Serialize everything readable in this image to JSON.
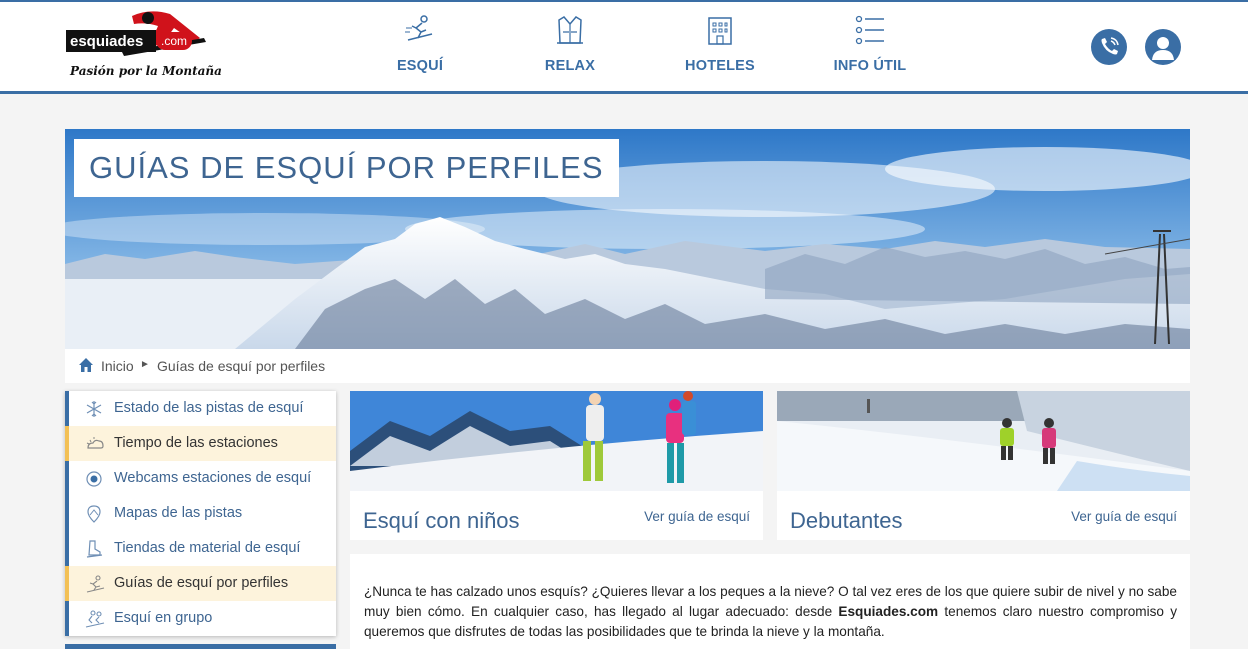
{
  "brand": {
    "name": "esquiades",
    "domain": ".com",
    "tagline": "Pasión por la Montaña"
  },
  "nav": {
    "items": [
      {
        "label": "ESQUÍ",
        "icon": "skier-icon"
      },
      {
        "label": "RELAX",
        "icon": "robe-icon"
      },
      {
        "label": "HOTELES",
        "icon": "hotel-icon"
      },
      {
        "label": "INFO ÚTIL",
        "icon": "list-icon"
      }
    ],
    "phone_icon": "phone-icon",
    "user_icon": "user-icon"
  },
  "hero": {
    "title": "GUÍAS DE ESQUÍ POR PERFILES"
  },
  "breadcrumb": {
    "home": "Inicio",
    "separator": "►",
    "current": "Guías de esquí por perfiles"
  },
  "sidebar": {
    "items": [
      {
        "label": "Estado de las pistas de esquí",
        "icon": "snowflake-icon",
        "highlighted": false
      },
      {
        "label": "Tiempo de las estaciones",
        "icon": "weather-icon",
        "highlighted": true
      },
      {
        "label": "Webcams estaciones de esquí",
        "icon": "webcam-icon",
        "highlighted": false
      },
      {
        "label": "Mapas de las pistas",
        "icon": "map-pin-icon",
        "highlighted": false
      },
      {
        "label": "Tiendas de material de esquí",
        "icon": "ski-boot-icon",
        "highlighted": false
      },
      {
        "label": "Guías de esquí por perfiles",
        "icon": "skier-icon",
        "highlighted": true
      },
      {
        "label": "Esquí en grupo",
        "icon": "group-skiers-icon",
        "highlighted": false
      }
    ]
  },
  "cards": [
    {
      "title": "Esquí con niños",
      "link": "Ver guía de esquí"
    },
    {
      "title": "Debutantes",
      "link": "Ver guía de esquí"
    }
  ],
  "intro": {
    "before": "¿Nunca te has calzado unos esquís? ¿Quieres llevar a los peques a la nieve? O tal vez eres de los que quiere subir de nivel y no sabe muy bien cómo. En cualquier caso, has llegado al lugar adecuado: desde ",
    "brand": "Esquiades.com",
    "after": " tenemos claro nuestro compromiso y queremos que disfrutes de todas las posibilidades que te brinda la nieve y la montaña."
  },
  "colors": {
    "accent": "#3a6ea5",
    "title_blue": "#3e6591",
    "highlight_bg": "#fdf3dc",
    "highlight_border": "#f3c054",
    "brand_red": "#d0121b"
  }
}
